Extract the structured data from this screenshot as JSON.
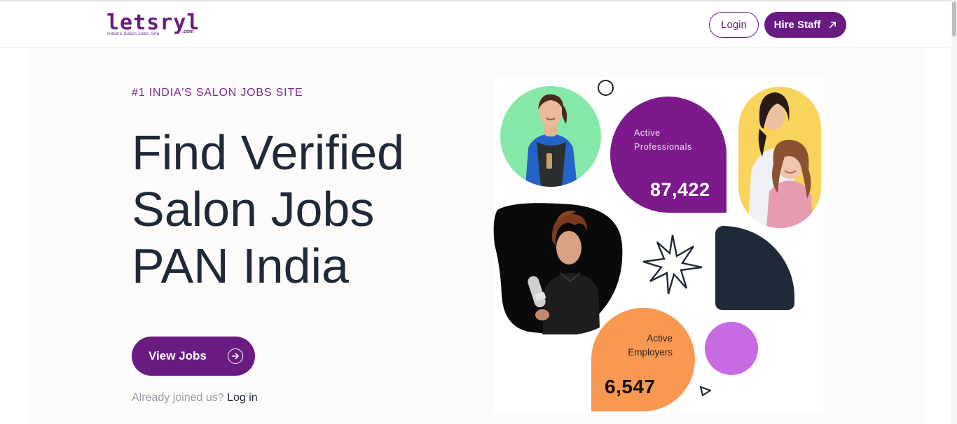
{
  "header": {
    "logo_word": "letsryl",
    "logo_tagline": "India's Salon Jobs Site",
    "logo_domain": ".com",
    "login_label": "Login",
    "hire_label": "Hire Staff"
  },
  "hero": {
    "eyebrow": "#1 INDIA'S SALON JOBS SITE",
    "headline_lines": [
      "Find Verified",
      "Salon Jobs",
      "PAN India"
    ],
    "cta_label": "View Jobs",
    "already_text": "Already joined us?",
    "login_link": "Log in"
  },
  "stats": {
    "professionals": {
      "label_line1": "Active",
      "label_line2": "Professionals",
      "value": "87,422"
    },
    "employers": {
      "label_line1": "Active",
      "label_line2": "Employers",
      "value": "6,547"
    }
  },
  "icons": {
    "hire_arrow": "arrow-up-right-icon",
    "cta_arrow": "arrow-right-circle-icon",
    "sparkle": "sparkle-star-icon",
    "triangle": "triangle-outline-icon",
    "ring": "ring-outline-icon"
  },
  "colors": {
    "brand_purple": "#6a1b82",
    "card_purple": "#7c1a8c",
    "orange": "#f99850",
    "navy": "#1f2937",
    "lilac": "#c86be3",
    "mint": "#86e8a8",
    "yellow": "#f9d45c"
  }
}
